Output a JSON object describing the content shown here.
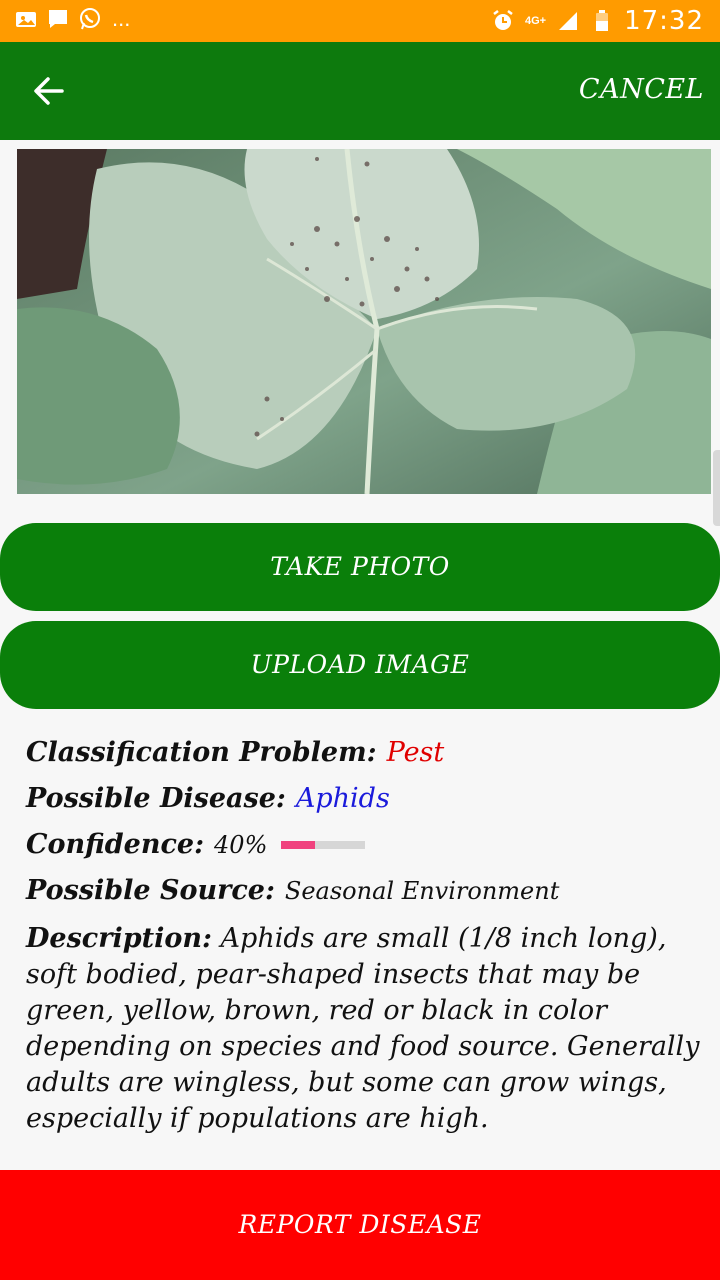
{
  "status_bar": {
    "time": "17:32",
    "network": "4G+",
    "more": "..."
  },
  "appbar": {
    "cancel_label": "CANCEL",
    "back_icon": "arrow-left-icon"
  },
  "buttons": {
    "take_photo": "TAKE PHOTO",
    "upload_image": "UPLOAD IMAGE",
    "report_disease": "REPORT DISEASE"
  },
  "result": {
    "classification_label": "Classification Problem:",
    "classification_value": "Pest",
    "disease_label": "Possible Disease:",
    "disease_value": "Aphids",
    "confidence_label": "Confidence:",
    "confidence_value": "40%",
    "confidence_fraction": 0.4,
    "source_label": "Possible Source:",
    "source_value": "Seasonal Environment",
    "description_label": "Description:",
    "description_value": "Aphids are small (1/8 inch long), soft bodied, pear-shaped insects that may be green, yellow, brown, red or black in color depending on species and food source. Generally adults are wingless, but some can grow wings, especially if populations are high."
  },
  "colors": {
    "status_bar": "#ff9b00",
    "app_bar": "#0d7a0d",
    "button": "#0a7f0a",
    "report": "#ff0000",
    "pest": "#e00000",
    "disease": "#1a1adb",
    "confidence_bar": "#f0427e"
  }
}
